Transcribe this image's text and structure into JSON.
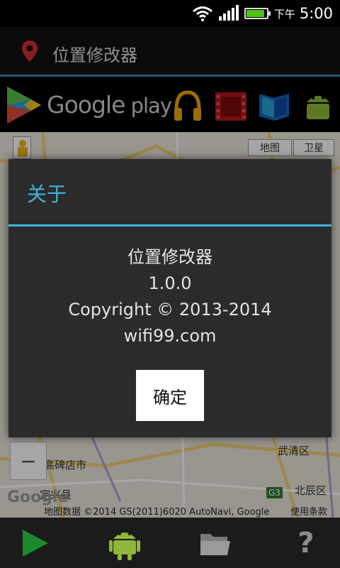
{
  "status_bar": {
    "ampm": "下午",
    "time": "5:00",
    "wifi_icon": "wifi-icon",
    "signal_icon": "signal-icon",
    "battery_icon": "battery-icon",
    "battery_level": 0.9
  },
  "title_bar": {
    "icon": "location-pin-icon",
    "title": "位置修改器"
  },
  "ad_banner": {
    "brand_word": "Google",
    "brand_suffix": " play",
    "icons": [
      "play-store-logo-icon",
      "headphones-icon",
      "film-icon",
      "book-icon",
      "android-icon"
    ]
  },
  "map": {
    "type_buttons": [
      "地图",
      "卫星"
    ],
    "zoom_out_label": "−",
    "labels": {
      "city_a": "高碑店市",
      "district_wuqing": "武清区",
      "district_beichen": "北辰区",
      "city_b": "定兴县",
      "road": "G3"
    },
    "logo": "Google",
    "attribution": "地图数据 ©2014 GS(2011)6020 AutoNavi, Google",
    "terms": "使用条款"
  },
  "dialog": {
    "title": "关于",
    "lines": [
      "位置修改器",
      "1.0.0",
      "Copyright © 2013-2014",
      "wifi99.com"
    ],
    "ok_label": "确定"
  },
  "toolbar": {
    "items": [
      "play-icon",
      "android-icon",
      "folder-icon",
      "help-icon"
    ],
    "help_glyph": "?"
  },
  "colors": {
    "accent": "#41b3e0",
    "title_divider": "#3a86b8",
    "play_green": "#1a8a2a",
    "android_green": "#8fb83a"
  }
}
